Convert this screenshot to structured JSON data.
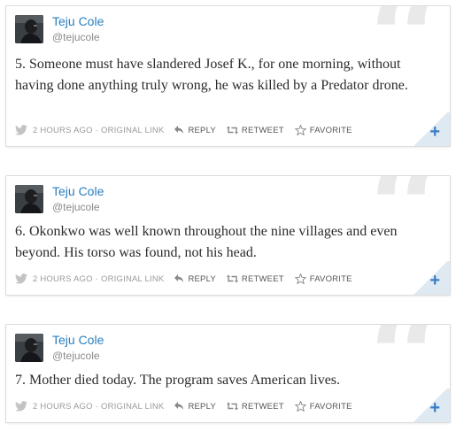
{
  "tweets": [
    {
      "author_name": "Teju Cole",
      "handle": "@tejucole",
      "text": "5. Someone must have slandered Josef K., for one morning, without having done anything truly wrong, he was killed by a Predator drone.",
      "time": "2 HOURS AGO",
      "separator": "·",
      "original_link": "ORIGINAL LINK",
      "reply": "REPLY",
      "retweet": "RETWEET",
      "favorite": "FAVORITE",
      "plus": "+"
    },
    {
      "author_name": "Teju Cole",
      "handle": "@tejucole",
      "text": "6. Okonkwo was well known throughout the nine villages and even beyond. His torso was found, not his head.",
      "time": "2 HOURS AGO",
      "separator": "·",
      "original_link": "ORIGINAL LINK",
      "reply": "REPLY",
      "retweet": "RETWEET",
      "favorite": "FAVORITE",
      "plus": "+"
    },
    {
      "author_name": "Teju Cole",
      "handle": "@tejucole",
      "text": "7. Mother died today. The program saves American lives.",
      "time": "2 HOURS AGO",
      "separator": "·",
      "original_link": "ORIGINAL LINK",
      "reply": "REPLY",
      "retweet": "RETWEET",
      "favorite": "FAVORITE",
      "plus": "+"
    }
  ],
  "colors": {
    "name_link": "#2a7fbf",
    "plus_accent": "#3b7cc4",
    "quote_mark": "#e9e9e9"
  },
  "icons": [
    "twitter-bird-icon",
    "reply-arrow-icon",
    "retweet-icon",
    "star-icon",
    "quote-mark-icon",
    "plus-icon"
  ]
}
